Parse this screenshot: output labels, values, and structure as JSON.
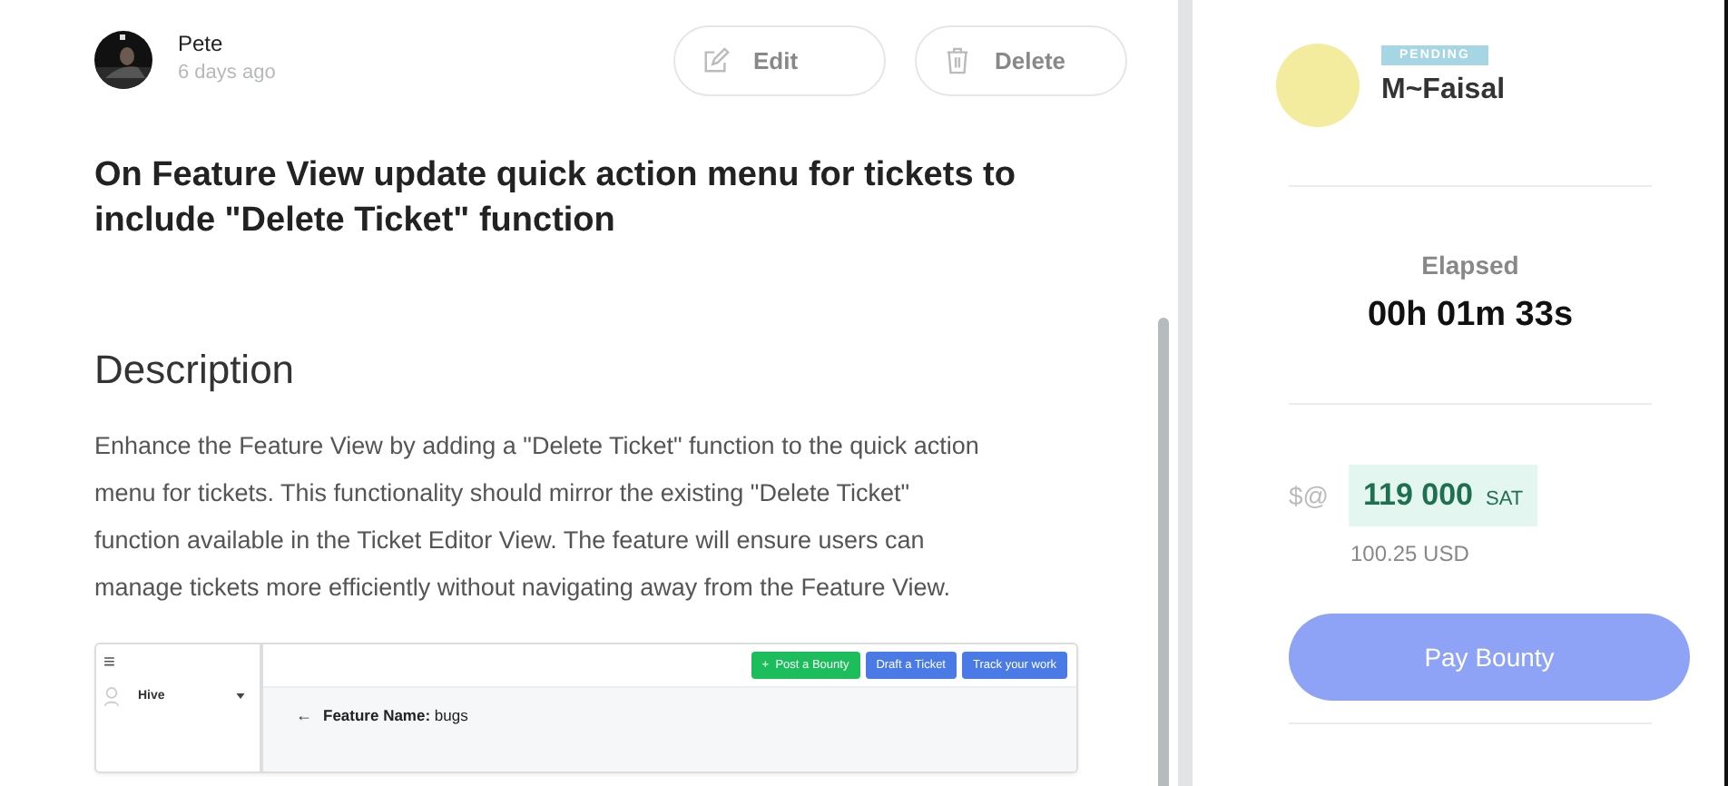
{
  "author": {
    "name": "Pete",
    "time": "6 days ago"
  },
  "actions": [
    {
      "label": "Edit",
      "kind": "edit"
    },
    {
      "label": "Delete",
      "kind": "delete"
    }
  ],
  "title": "On Feature View update quick action menu for tickets to include \"Delete Ticket\" function",
  "description": {
    "heading": "Description",
    "body": "Enhance the Feature View by adding a \"Delete Ticket\" function to the quick action menu for tickets. This functionality should mirror the existing \"Delete Ticket\" function available in the Ticket Editor View. The feature will ensure users can manage tickets more efficiently without navigating away from the Feature View."
  },
  "embedded_screenshot": {
    "menu_glyph": "≡",
    "workspace": "Hive",
    "buttons": [
      {
        "label": "Post a Bounty",
        "prefix": "+",
        "kind": "green"
      },
      {
        "label": "Draft a Ticket",
        "kind": "blue"
      },
      {
        "label": "Track your work",
        "kind": "blue"
      }
    ],
    "back_glyph": "←",
    "feature": "**Feature Name:** bugs"
  },
  "assignee": {
    "status": "PENDING",
    "name": "M~Faisal"
  },
  "elapsed": {
    "label": "Elapsed",
    "value": "00h 01m 33s"
  },
  "bounty": {
    "symbol": "$@",
    "amount": "119 000",
    "unit": "SAT",
    "usd": "100.25 USD"
  },
  "pay_button": "Pay Bounty"
}
